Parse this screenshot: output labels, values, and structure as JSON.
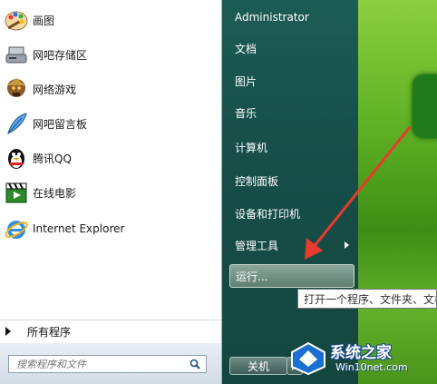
{
  "programs": [
    {
      "label": "画图",
      "icon": "paint-icon"
    },
    {
      "label": "网吧存储区",
      "icon": "storage-device-icon"
    },
    {
      "label": "网络游戏",
      "icon": "game-character-icon"
    },
    {
      "label": "网吧留言板",
      "icon": "feather-pen-icon"
    },
    {
      "label": "腾讯QQ",
      "icon": "qq-penguin-icon"
    },
    {
      "label": "在线电影",
      "icon": "film-clapper-icon"
    },
    {
      "label": "Internet Explorer",
      "icon": "internet-explorer-icon"
    }
  ],
  "all_programs_label": "所有程序",
  "search": {
    "placeholder": "搜索程序和文件"
  },
  "right_menu": [
    {
      "label": "Administrator"
    },
    {
      "label": "文档"
    },
    {
      "label": "图片"
    },
    {
      "label": "音乐"
    },
    {
      "label": "计算机"
    },
    {
      "label": "控制面板"
    },
    {
      "label": "设备和打印机"
    },
    {
      "label": "管理工具"
    },
    {
      "label": "运行..."
    }
  ],
  "shutdown_label": "关机",
  "tooltip": "打开一个程序、文件夹、文档",
  "watermark": {
    "title": "系统之家",
    "url": "Win10net.com"
  },
  "colors": {
    "arrow": "#e63b2e",
    "right_pane": "#1a5650",
    "hover": "#7b998b"
  }
}
